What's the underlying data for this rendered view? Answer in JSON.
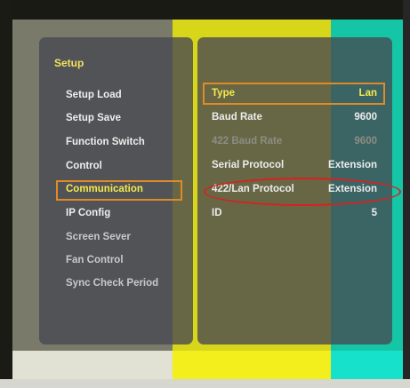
{
  "setup": {
    "title": "Setup",
    "menu": [
      {
        "label": "Setup Load"
      },
      {
        "label": "Setup Save"
      },
      {
        "label": "Function Switch"
      },
      {
        "label": "Control"
      },
      {
        "label": "Communication"
      },
      {
        "label": "IP Config"
      },
      {
        "label": "Screen Sever"
      },
      {
        "label": "Fan Control"
      },
      {
        "label": "Sync Check Period"
      }
    ],
    "selected_index": 4
  },
  "communication": {
    "rows": [
      {
        "label": "Type",
        "value": "Lan"
      },
      {
        "label": "Baud Rate",
        "value": "9600"
      },
      {
        "label": "422 Baud Rate",
        "value": "9600"
      },
      {
        "label": "Serial Protocol",
        "value": "Extension"
      },
      {
        "label": "422/Lan Protocol",
        "value": "Extension"
      },
      {
        "label": "ID",
        "value": "5"
      }
    ],
    "highlighted_row": "422/Lan Protocol"
  },
  "colors": {
    "highlight_box": "#e08a28",
    "annotation_oval": "#d8211f",
    "title_text": "#f0e25a"
  }
}
